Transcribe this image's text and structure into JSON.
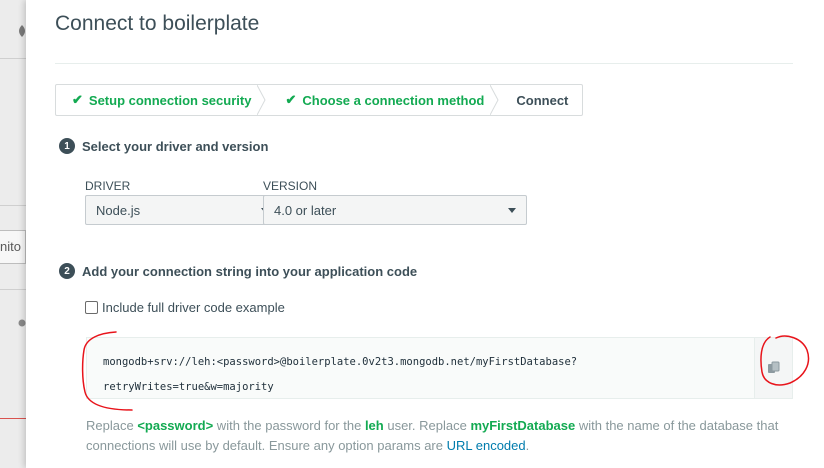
{
  "background": {
    "fragment_1": "nito"
  },
  "modal": {
    "title": "Connect to boilerplate",
    "steps": [
      {
        "label": "Setup connection security",
        "state": "done"
      },
      {
        "label": "Choose a connection method",
        "state": "done"
      },
      {
        "label": "Connect",
        "state": "current"
      }
    ],
    "section1": {
      "number": "1",
      "heading": "Select your driver and version",
      "driver_label": "DRIVER",
      "driver_value": "Node.js",
      "version_label": "VERSION",
      "version_value": "4.0 or later"
    },
    "section2": {
      "number": "2",
      "heading": "Add your connection string into your application code",
      "checkbox_label": "Include full driver code example",
      "connection_line1": "mongodb+srv://leh:<password>@boilerplate.0v2t3.mongodb.net/myFirstDatabase?",
      "connection_line2": "retryWrites=true&w=majority",
      "help": {
        "t1": "Replace ",
        "password_token": "<password>",
        "t2": " with the password for the ",
        "user": "leh",
        "t3": " user. Replace ",
        "db_token": "myFirstDatabase",
        "t4": " with the name of the database that connections will use by default. Ensure any option params are ",
        "link": "URL encoded",
        "t5": "."
      }
    }
  },
  "colors": {
    "success": "#13aa52",
    "text": "#3d4f58",
    "link": "#007cad",
    "annotation": "#e8141b"
  },
  "icons": {
    "step_check": "checkmark-icon",
    "copy": "copy-icon"
  }
}
